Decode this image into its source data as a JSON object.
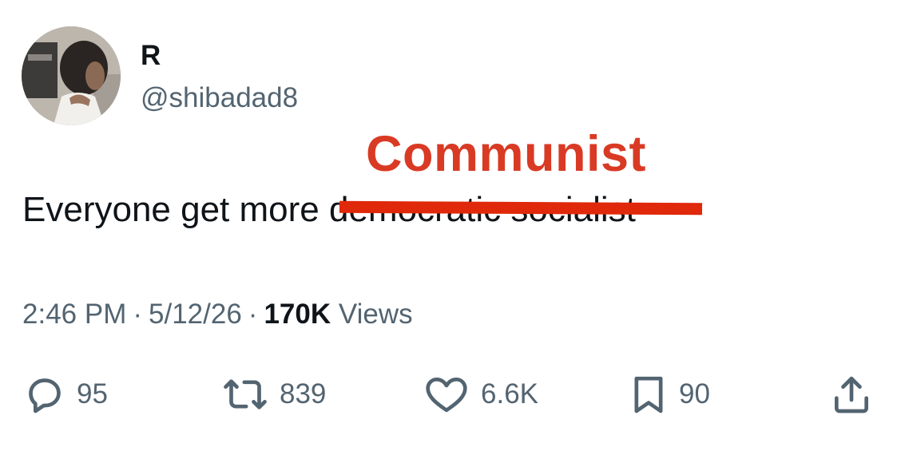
{
  "user": {
    "display_name": "R",
    "handle": "@shibadad8"
  },
  "tweet": {
    "text_prefix": "Everyone get more ",
    "struck_text": "democratic socialist",
    "annotation": "Communist",
    "annotation_color": "#d93a24",
    "strike_color": "#e0280a"
  },
  "meta": {
    "time": "2:46 PM",
    "sep1": "·",
    "date": "5/12/26",
    "sep2": "·",
    "views_count": "170K",
    "views_label": "Views"
  },
  "actions": {
    "replies": "95",
    "reposts": "839",
    "likes": "6.6K",
    "bookmarks": "90"
  },
  "icons": {
    "reply": "reply-icon",
    "repost": "repost-icon",
    "like": "heart-icon",
    "bookmark": "bookmark-icon",
    "share": "share-icon"
  },
  "colors": {
    "text": "#0f1419",
    "secondary": "#536471"
  }
}
